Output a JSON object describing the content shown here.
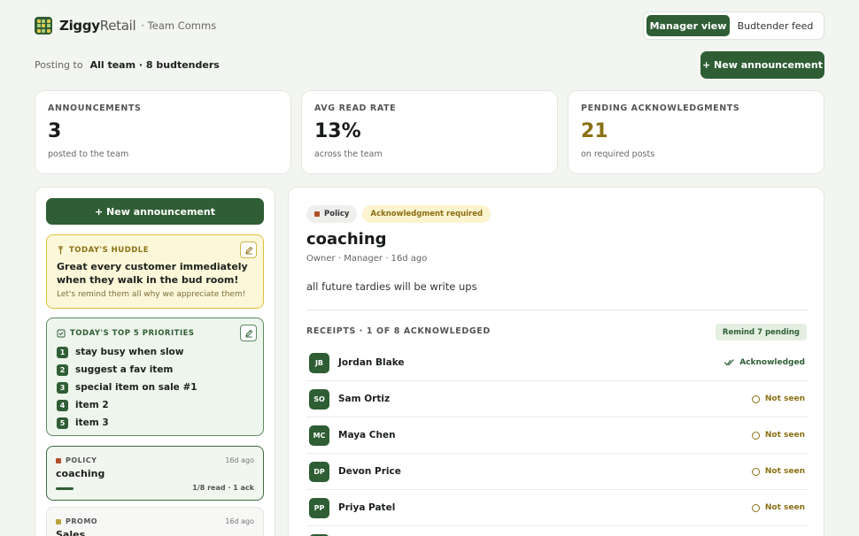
{
  "brand": {
    "name_bold": "Ziggy",
    "name_light": "Retail",
    "subtitle": "· Team Comms"
  },
  "view_toggle": {
    "manager": "Manager view",
    "budtender": "Budtender feed"
  },
  "posting": {
    "label": "Posting to",
    "target": "All team · 8 budtenders"
  },
  "new_announcement_label": "+ New announcement",
  "stats": [
    {
      "label": "ANNOUNCEMENTS",
      "value": "3",
      "sub": "posted to the team",
      "color": "#181c18"
    },
    {
      "label": "AVG READ RATE",
      "value": "13%",
      "sub": "across the team",
      "color": "#181c18"
    },
    {
      "label": "PENDING ACKNOWLEDGMENTS",
      "value": "21",
      "sub": "on required posts",
      "color": "#8a7014"
    }
  ],
  "huddle": {
    "title": "TODAY'S HUDDLE",
    "message": "Great every customer immediately when they walk in the bud room!",
    "sub": "Let's remind them all why we appreciate them!"
  },
  "priorities": {
    "title": "TODAY'S TOP 5 PRIORITIES",
    "items": [
      {
        "n": "1",
        "text": "stay busy when slow"
      },
      {
        "n": "2",
        "text": "suggest a fav item"
      },
      {
        "n": "3",
        "text": "special item on sale #1"
      },
      {
        "n": "4",
        "text": "item 2"
      },
      {
        "n": "5",
        "text": "item 3"
      }
    ]
  },
  "announcements": [
    {
      "tag": "POLICY",
      "time": "16d ago",
      "title": "coaching",
      "stats": "1/8 read · 1 ack",
      "read_fraction": 0.125,
      "tag_color": "#b0502a"
    },
    {
      "tag": "PROMO",
      "time": "16d ago",
      "title": "Sales",
      "tag_color": "#b8a43a"
    }
  ],
  "post": {
    "chips": {
      "category": "Policy",
      "ack": "Acknowledgment required"
    },
    "title": "coaching",
    "meta": "Owner · Manager · 16d ago",
    "body": "all future tardies will be write ups",
    "receipts_title": "RECEIPTS · 1 OF 8 ACKNOWLEDGED",
    "remind": "Remind 7 pending",
    "receipts": [
      {
        "initials": "JB",
        "name": "Jordan Blake",
        "status": "Acknowledged",
        "state": "ack"
      },
      {
        "initials": "SO",
        "name": "Sam Ortiz",
        "status": "Not seen",
        "state": "unseen"
      },
      {
        "initials": "MC",
        "name": "Maya Chen",
        "status": "Not seen",
        "state": "unseen"
      },
      {
        "initials": "DP",
        "name": "Devon Price",
        "status": "Not seen",
        "state": "unseen"
      },
      {
        "initials": "PP",
        "name": "Priya Patel",
        "status": "Not seen",
        "state": "unseen"
      },
      {
        "initials": "",
        "name": "",
        "status": "",
        "state": "unseen"
      }
    ]
  },
  "colors": {
    "brand_green": "#2f5e35",
    "warning_gold": "#8a7014",
    "policy_tag": "#b0502a",
    "promo_tag": "#b8a43a"
  }
}
